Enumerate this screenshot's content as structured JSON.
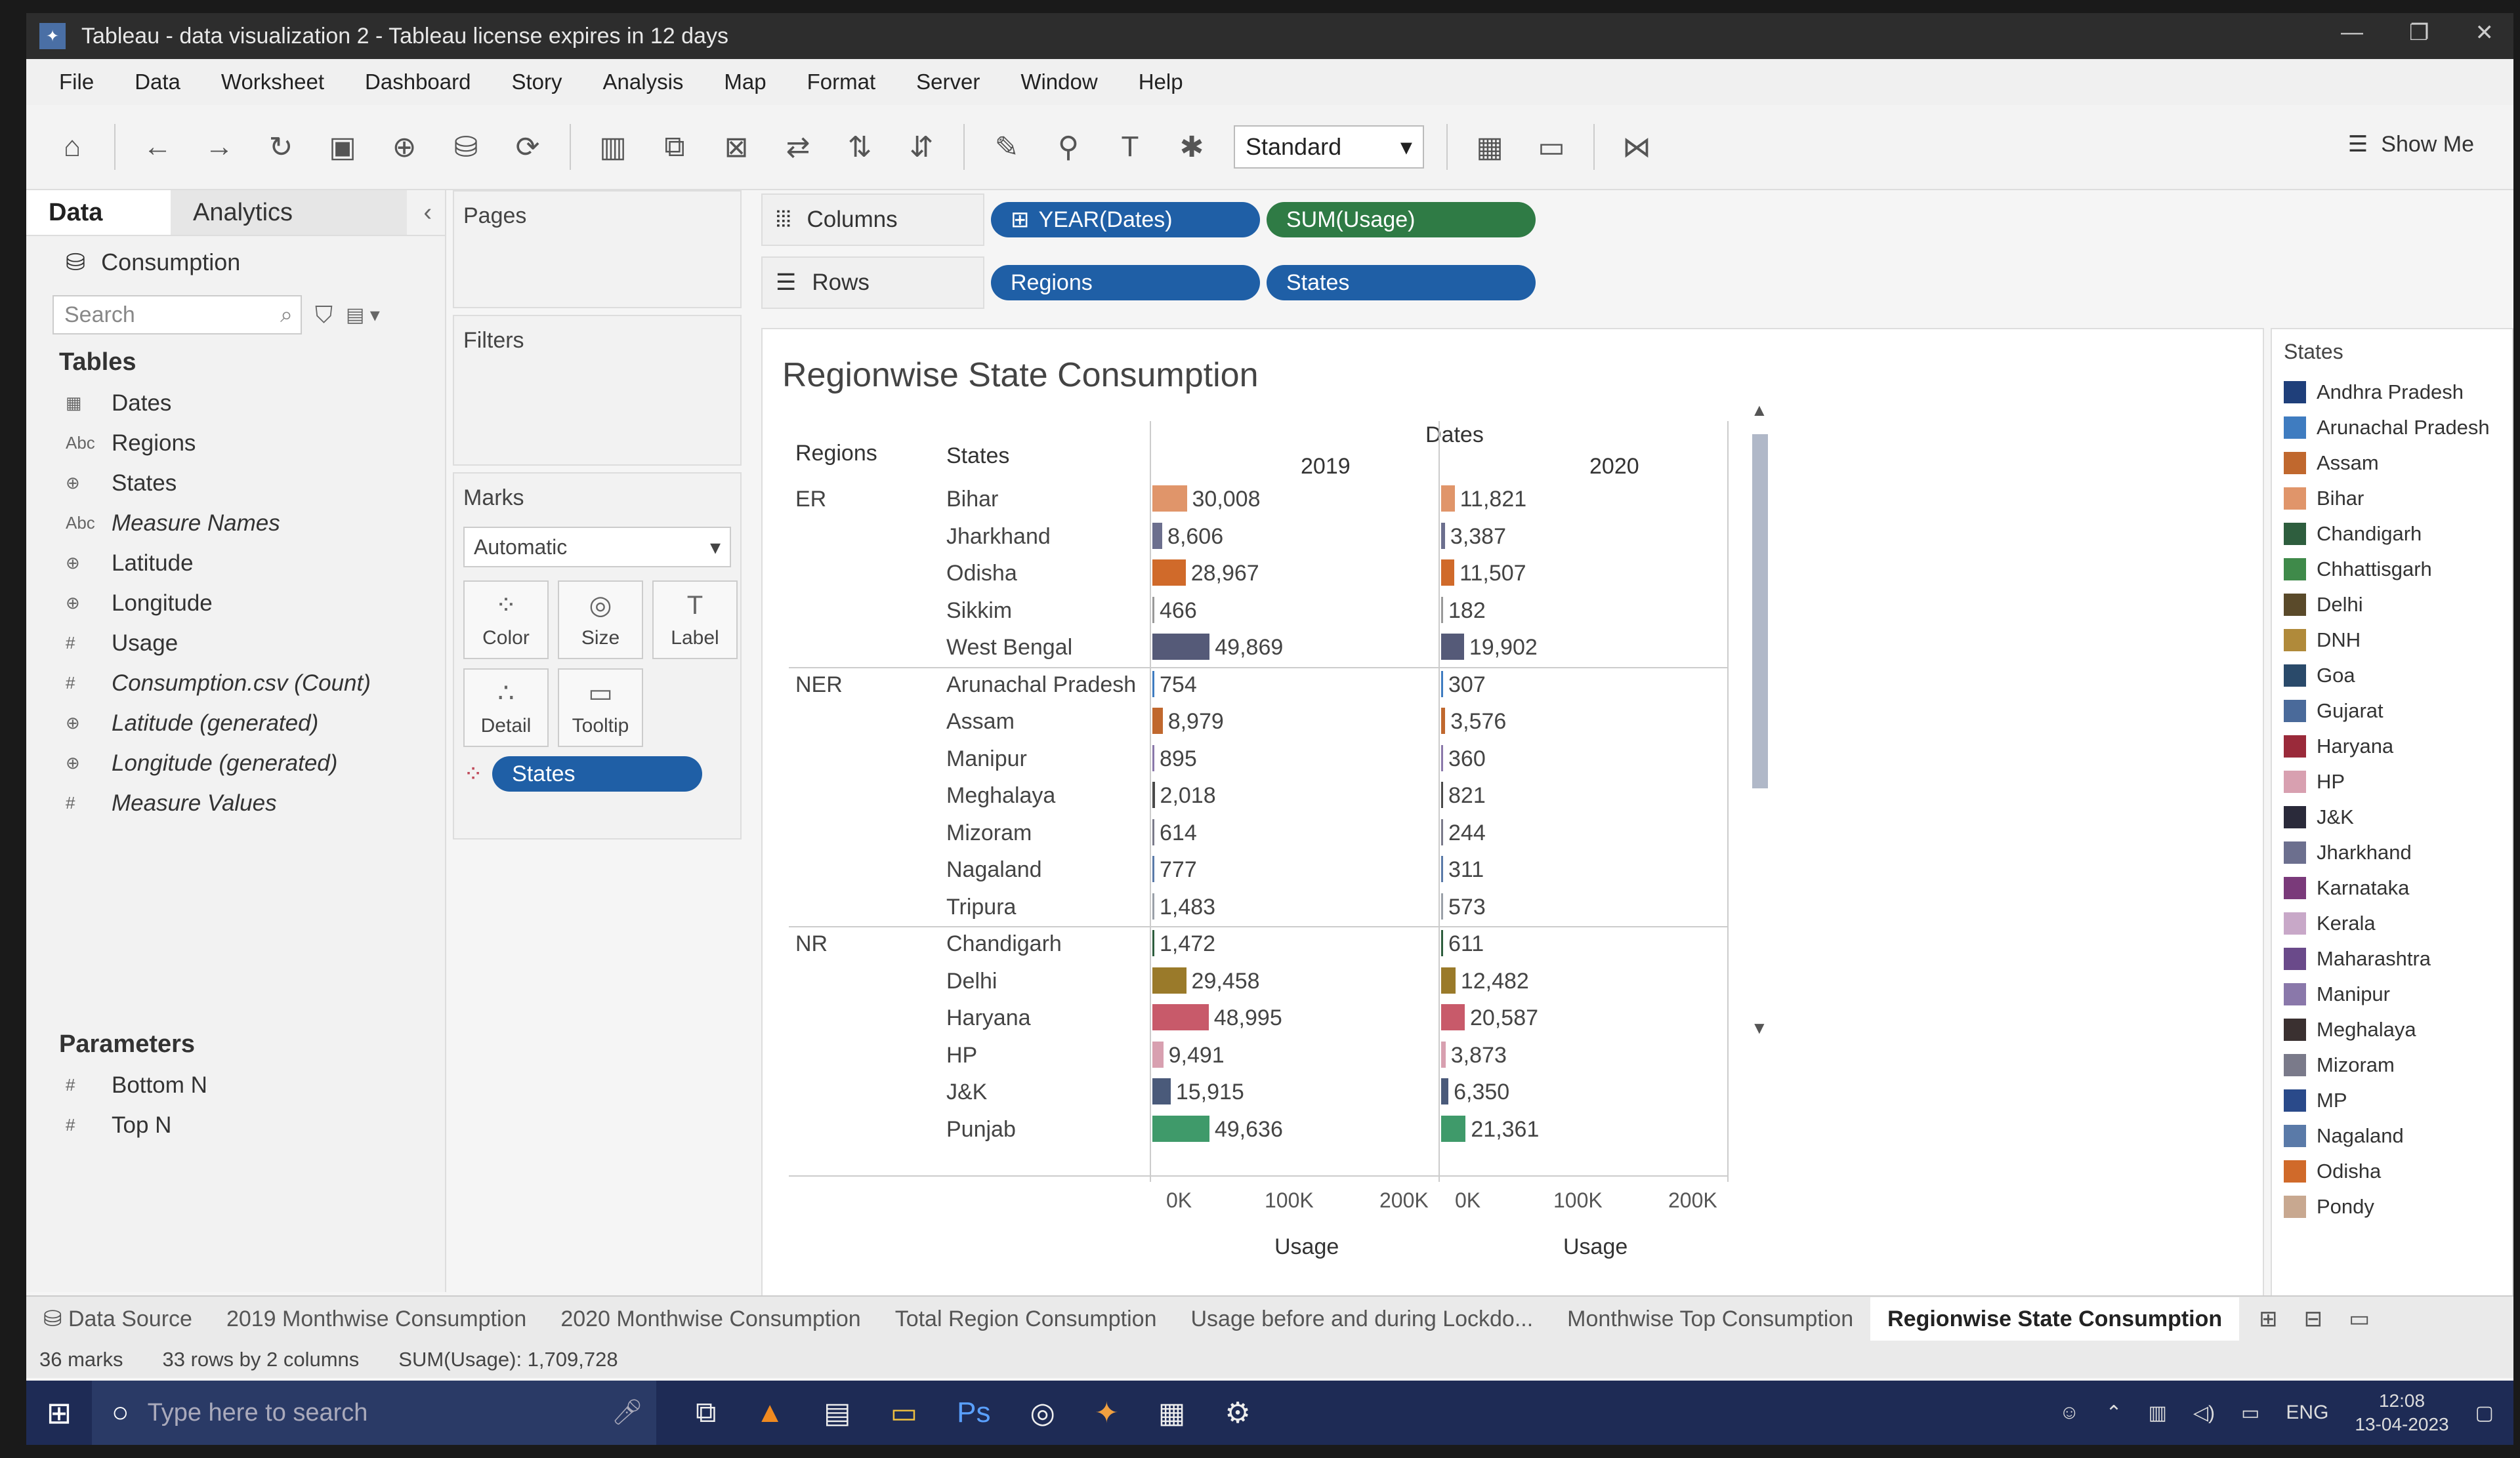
{
  "window": {
    "title": "Tableau - data visualization 2 - Tableau license expires in 12 days"
  },
  "menu": [
    "File",
    "Data",
    "Worksheet",
    "Dashboard",
    "Story",
    "Analysis",
    "Map",
    "Format",
    "Server",
    "Window",
    "Help"
  ],
  "toolbar": {
    "fit": "Standard",
    "show_me": "Show Me"
  },
  "data_pane": {
    "tab_data": "Data",
    "tab_analytics": "Analytics",
    "datasource": "Consumption",
    "search_placeholder": "Search",
    "tables_heading": "Tables",
    "fields": [
      {
        "type": "date",
        "name": "Dates"
      },
      {
        "type": "Abc",
        "name": "Regions"
      },
      {
        "type": "geo",
        "name": "States"
      },
      {
        "type": "Abc",
        "name": "Measure Names"
      },
      {
        "type": "geo",
        "name": "Latitude"
      },
      {
        "type": "geo",
        "name": "Longitude"
      },
      {
        "type": "#",
        "name": "Usage"
      },
      {
        "type": "#",
        "name": "Consumption.csv (Count)"
      },
      {
        "type": "geo",
        "name": "Latitude (generated)"
      },
      {
        "type": "geo",
        "name": "Longitude (generated)"
      },
      {
        "type": "#",
        "name": "Measure Values"
      }
    ],
    "parameters_heading": "Parameters",
    "parameters": [
      "Bottom N",
      "Top N"
    ]
  },
  "cards": {
    "pages": "Pages",
    "filters": "Filters",
    "marks": "Marks",
    "mark_type": "Automatic",
    "mark_buttons": [
      "Color",
      "Size",
      "Label",
      "Detail",
      "Tooltip"
    ],
    "marks_pill": "States"
  },
  "shelves": {
    "columns_label": "Columns",
    "rows_label": "Rows",
    "columns": [
      "YEAR(Dates)",
      "SUM(Usage)"
    ],
    "rows": [
      "Regions",
      "States"
    ]
  },
  "viz": {
    "title": "Regionwise State Consumption",
    "header_regions": "Regions",
    "header_states": "States",
    "header_dates": "Dates",
    "year_2019": "2019",
    "year_2020": "2020",
    "axis_ticks": [
      "0K",
      "100K",
      "200K"
    ],
    "axis_label": "Usage"
  },
  "chart_data": {
    "type": "bar",
    "title": "Regionwise State Consumption",
    "xlabel": "Usage",
    "xlim": [
      0,
      250000
    ],
    "rows": [
      {
        "region": "ER",
        "state": "Bihar",
        "v2019": 30008,
        "l2019": "30,008",
        "v2020": 11821,
        "l2020": "11,821",
        "color": "#e0956a"
      },
      {
        "region": "",
        "state": "Jharkhand",
        "v2019": 8606,
        "l2019": "8,606",
        "v2020": 3387,
        "l2020": "3,387",
        "color": "#6c6f8e"
      },
      {
        "region": "",
        "state": "Odisha",
        "v2019": 28967,
        "l2019": "28,967",
        "v2020": 11507,
        "l2020": "11,507",
        "color": "#d06a2a"
      },
      {
        "region": "",
        "state": "Sikkim",
        "v2019": 466,
        "l2019": "466",
        "v2020": 182,
        "l2020": "182",
        "color": "#999999"
      },
      {
        "region": "",
        "state": "West Bengal",
        "v2019": 49869,
        "l2019": "49,869",
        "v2020": 19902,
        "l2020": "19,902",
        "color": "#555a78"
      },
      {
        "region": "NER",
        "state": "Arunachal Pradesh",
        "v2019": 754,
        "l2019": "754",
        "v2020": 307,
        "l2020": "307",
        "color": "#3f7cc0"
      },
      {
        "region": "",
        "state": "Assam",
        "v2019": 8979,
        "l2019": "8,979",
        "v2020": 3576,
        "l2020": "3,576",
        "color": "#c0682e"
      },
      {
        "region": "",
        "state": "Manipur",
        "v2019": 895,
        "l2019": "895",
        "v2020": 360,
        "l2020": "360",
        "color": "#8a78aa"
      },
      {
        "region": "",
        "state": "Meghalaya",
        "v2019": 2018,
        "l2019": "2,018",
        "v2020": 821,
        "l2020": "821",
        "color": "#4a4a4a"
      },
      {
        "region": "",
        "state": "Mizoram",
        "v2019": 614,
        "l2019": "614",
        "v2020": 244,
        "l2020": "244",
        "color": "#7a7a8a"
      },
      {
        "region": "",
        "state": "Nagaland",
        "v2019": 777,
        "l2019": "777",
        "v2020": 311,
        "l2020": "311",
        "color": "#5a7aa8"
      },
      {
        "region": "",
        "state": "Tripura",
        "v2019": 1483,
        "l2019": "1,483",
        "v2020": 573,
        "l2020": "573",
        "color": "#9aa0a8"
      },
      {
        "region": "NR",
        "state": "Chandigarh",
        "v2019": 1472,
        "l2019": "1,472",
        "v2020": 611,
        "l2020": "611",
        "color": "#2e5e3e"
      },
      {
        "region": "",
        "state": "Delhi",
        "v2019": 29458,
        "l2019": "29,458",
        "v2020": 12482,
        "l2020": "12,482",
        "color": "#9a7a2a"
      },
      {
        "region": "",
        "state": "Haryana",
        "v2019": 48995,
        "l2019": "48,995",
        "v2020": 20587,
        "l2020": "20,587",
        "color": "#c85a6a"
      },
      {
        "region": "",
        "state": "HP",
        "v2019": 9491,
        "l2019": "9,491",
        "v2020": 3873,
        "l2020": "3,873",
        "color": "#d8a0b0"
      },
      {
        "region": "",
        "state": "J&K",
        "v2019": 15915,
        "l2019": "15,915",
        "v2020": 6350,
        "l2020": "6,350",
        "color": "#4a5a7a"
      },
      {
        "region": "",
        "state": "Punjab",
        "v2019": 49636,
        "l2019": "49,636",
        "v2020": 21361,
        "l2020": "21,361",
        "color": "#3f9a6a"
      }
    ]
  },
  "legend": {
    "title": "States",
    "items": [
      {
        "name": "Andhra Pradesh",
        "color": "#1f3f7a"
      },
      {
        "name": "Arunachal Pradesh",
        "color": "#3f7cc0"
      },
      {
        "name": "Assam",
        "color": "#c0682e"
      },
      {
        "name": "Bihar",
        "color": "#e0956a"
      },
      {
        "name": "Chandigarh",
        "color": "#2e5e3e"
      },
      {
        "name": "Chhattisgarh",
        "color": "#3f8a4a"
      },
      {
        "name": "Delhi",
        "color": "#5a4a2a"
      },
      {
        "name": "DNH",
        "color": "#b08a3a"
      },
      {
        "name": "Goa",
        "color": "#2a4a6a"
      },
      {
        "name": "Gujarat",
        "color": "#4a6a9a"
      },
      {
        "name": "Haryana",
        "color": "#9a2a3a"
      },
      {
        "name": "HP",
        "color": "#d8a0b0"
      },
      {
        "name": "J&K",
        "color": "#2a2a3a"
      },
      {
        "name": "Jharkhand",
        "color": "#6c6f8e"
      },
      {
        "name": "Karnataka",
        "color": "#7a3a7a"
      },
      {
        "name": "Kerala",
        "color": "#c8a8c8"
      },
      {
        "name": "Maharashtra",
        "color": "#6a4a8a"
      },
      {
        "name": "Manipur",
        "color": "#8a78aa"
      },
      {
        "name": "Meghalaya",
        "color": "#3a3030"
      },
      {
        "name": "Mizoram",
        "color": "#7a7a8a"
      },
      {
        "name": "MP",
        "color": "#2a4a8a"
      },
      {
        "name": "Nagaland",
        "color": "#5a7aa8"
      },
      {
        "name": "Odisha",
        "color": "#d06a2a"
      },
      {
        "name": "Pondy",
        "color": "#c8a890"
      }
    ]
  },
  "sheet_tabs": {
    "data_source": "Data Source",
    "tabs": [
      "2019 Monthwise Consumption",
      "2020 Monthwise Consumption",
      "Total Region Consumption",
      "Usage before and during Lockdo...",
      "Monthwise Top Consumption",
      "Regionwise State Consumption"
    ],
    "active": "Regionwise State Consumption"
  },
  "status": {
    "marks": "36 marks",
    "dims": "33 rows by 2 columns",
    "sum": "SUM(Usage): 1,709,728"
  },
  "taskbar": {
    "search_placeholder": "Type here to search",
    "lang": "ENG",
    "time": "12:08",
    "date": "13-04-2023"
  }
}
